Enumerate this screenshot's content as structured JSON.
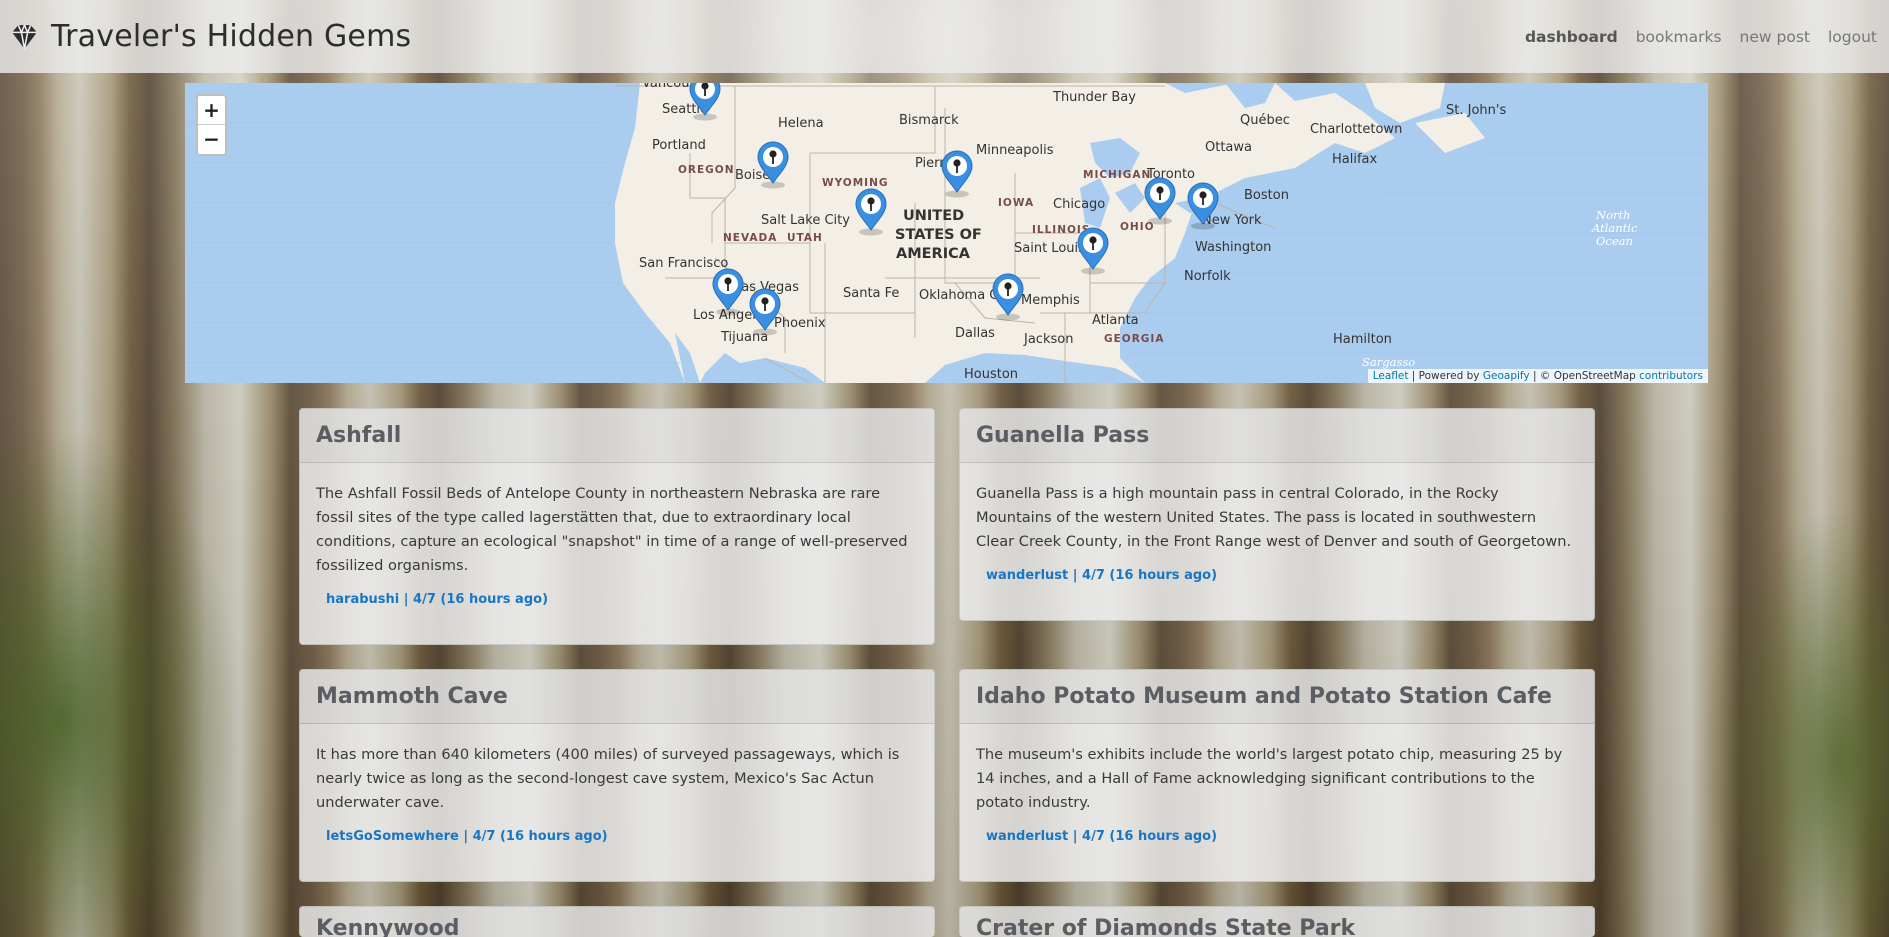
{
  "header": {
    "title": "Traveler's Hidden Gems",
    "brand_icon": "gem-icon",
    "nav": [
      {
        "label": "dashboard",
        "active": true
      },
      {
        "label": "bookmarks",
        "active": false
      },
      {
        "label": "new post",
        "active": false
      },
      {
        "label": "logout",
        "active": false
      }
    ]
  },
  "map": {
    "zoom_in": "+",
    "zoom_out": "−",
    "attribution": {
      "leaflet": "Leaflet",
      "powered_by": " | Powered by ",
      "geoapify": "Geoapify",
      "osm": " | © OpenStreetMap ",
      "contributors": "contributors"
    },
    "labels": {
      "vancouver": "Vancouver",
      "seattle": "Seattle",
      "helena": "Helena",
      "bismarck": "Bismarck",
      "thunder_bay": "Thunder Bay",
      "quebec": "Québec",
      "charlottetown": "Charlottetown",
      "st_johns": "St. John's",
      "portland": "Portland",
      "oregon": "OREGON",
      "boise": "Boise",
      "wyoming": "WYOMING",
      "pierre": "Pierre",
      "minneapolis": "Minneapolis",
      "michigan": "MICHIGAN",
      "toronto": "Toronto",
      "ottawa": "Ottawa",
      "halifax": "Halifax",
      "iowa": "IOWA",
      "chicago": "Chicago",
      "boston": "Boston",
      "salt_lake": "Salt Lake City",
      "usa_1": "UNITED",
      "usa_2": "STATES OF",
      "usa_3": "AMERICA",
      "illinois": "ILLINOIS",
      "ohio": "OHIO",
      "new_york": "New York",
      "nevada": "NEVADA",
      "utah": "UTAH",
      "st_louis": "Saint Louis",
      "washington": "Washington",
      "sf": "San Francisco",
      "norfolk": "Norfolk",
      "las_vegas": "Las Vegas",
      "santa_fe": "Santa Fe",
      "oklahoma": "Oklahoma City",
      "memphis": "Memphis",
      "los_angeles": "Los Angeles",
      "phoenix": "Phoenix",
      "tijuana": "Tijuana",
      "atlanta": "Atlanta",
      "dallas": "Dallas",
      "jackson": "Jackson",
      "georgia": "GEORGIA",
      "hamilton": "Hamilton",
      "houston": "Houston",
      "north_atlantic_1": "North",
      "north_atlantic_2": "Atlantic",
      "north_atlantic_3": "Ocean",
      "sargasso": "Sargasso"
    },
    "marker_icon": "map-pin-icon"
  },
  "posts": [
    {
      "title": "Ashfall",
      "text": "The Ashfall Fossil Beds of Antelope County in northeastern Nebraska are rare fossil sites of the type called lagerstätten that, due to extraordinary local conditions, capture an ecological \"snapshot\" in time of a range of well-preserved fossilized organisms.",
      "meta": "harabushi | 4/7 (16 hours ago)"
    },
    {
      "title": "Guanella Pass",
      "text": "Guanella Pass is a high mountain pass in central Colorado, in the Rocky Mountains of the western United States. The pass is located in southwestern Clear Creek County, in the Front Range west of Denver and south of Georgetown.",
      "meta": "wanderlust | 4/7 (16 hours ago)"
    },
    {
      "title": "Mammoth Cave",
      "text": "It has more than 640 kilometers (400 miles) of surveyed passageways, which is nearly twice as long as the second-longest cave system, Mexico's Sac Actun underwater cave.",
      "meta": "letsGoSomewhere | 4/7 (16 hours ago)"
    },
    {
      "title": "Idaho Potato Museum and Potato Station Cafe",
      "text": "The museum's exhibits include the world's largest potato chip, measuring 25 by 14 inches, and a Hall of Fame acknowledging significant contributions to the potato industry.",
      "meta": "wanderlust | 4/7 (16 hours ago)"
    },
    {
      "title": "Kennywood",
      "text": "",
      "meta": ""
    },
    {
      "title": "Crater of Diamonds State Park",
      "text": "",
      "meta": ""
    }
  ]
}
